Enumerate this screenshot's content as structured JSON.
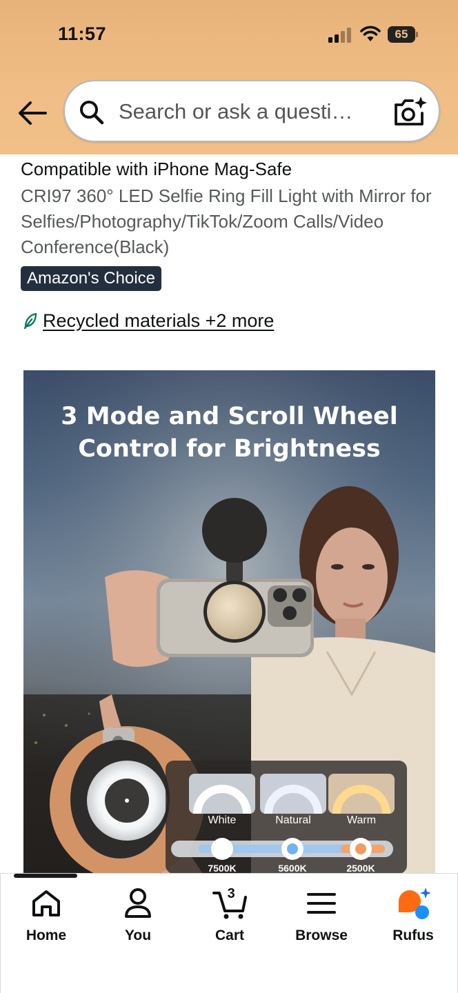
{
  "status_bar": {
    "time": "11:57",
    "battery_percent": "65",
    "signal_bars_active": 2,
    "signal_bars_total": 4
  },
  "header": {
    "back_icon": "arrow-left-icon",
    "search_placeholder": "Search or ask a questi…",
    "search_icon": "search-icon",
    "camera_icon": "camera-sparkle-icon"
  },
  "product": {
    "title_line": "Compatible with iPhone Mag-Safe",
    "subtitle": "CRI97 360° LED Selfie Ring Fill Light with Mirror for Selfies/Photography/TikTok/Zoom Calls/Video Conference(Black)",
    "badge": "Amazon's Choice",
    "sustainability_link": "Recycled materials +2 more",
    "sustainability_icon": "leaf-icon"
  },
  "product_image": {
    "headline_line1": "3 Mode and Scroll Wheel",
    "headline_line2": "Control for Brightness",
    "modes": [
      {
        "label": "White",
        "kelvin": "7500K"
      },
      {
        "label": "Natural",
        "kelvin": "5600K"
      },
      {
        "label": "Warm",
        "kelvin": "2500K"
      }
    ]
  },
  "bottom_nav": {
    "items": [
      {
        "label": "Home",
        "icon": "home-icon"
      },
      {
        "label": "You",
        "icon": "person-icon"
      },
      {
        "label": "Cart",
        "icon": "cart-icon",
        "count": "3"
      },
      {
        "label": "Browse",
        "icon": "menu-icon"
      },
      {
        "label": "Rufus",
        "icon": "rufus-icon"
      }
    ]
  },
  "colors": {
    "header_bg": "#efbd85",
    "badge_bg": "#232f3e",
    "rufus_orange": "#ff6a13",
    "rufus_blue": "#1a8fff"
  }
}
